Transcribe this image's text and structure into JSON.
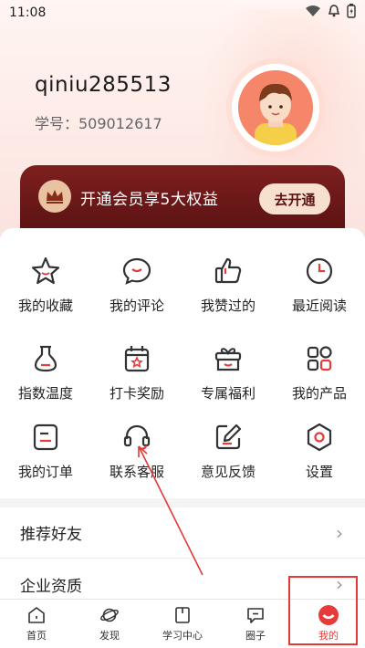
{
  "status_bar": {
    "time": "11:08"
  },
  "profile": {
    "username": "qiniu285513",
    "student_id": "学号：509012617"
  },
  "vip": {
    "text": "开通会员享5大权益",
    "button": "去开通"
  },
  "grid": [
    {
      "label": "我的收藏",
      "icon": "star-icon"
    },
    {
      "label": "我的评论",
      "icon": "comment-icon"
    },
    {
      "label": "我赞过的",
      "icon": "thumbs-up-icon"
    },
    {
      "label": "最近阅读",
      "icon": "clock-icon"
    },
    {
      "label": "指数温度",
      "icon": "flask-icon"
    },
    {
      "label": "打卡奖励",
      "icon": "calendar-star-icon"
    },
    {
      "label": "专属福利",
      "icon": "gift-box-icon"
    },
    {
      "label": "我的产品",
      "icon": "grid-apps-icon"
    },
    {
      "label": "我的订单",
      "icon": "order-icon"
    },
    {
      "label": "联系客服",
      "icon": "headset-icon"
    },
    {
      "label": "意见反馈",
      "icon": "feedback-edit-icon"
    },
    {
      "label": "设置",
      "icon": "hexagon-settings-icon"
    }
  ],
  "list": [
    {
      "label": "推荐好友"
    },
    {
      "label": "企业资质"
    }
  ],
  "tabbar": [
    {
      "label": "首页",
      "icon": "home-icon"
    },
    {
      "label": "发现",
      "icon": "planet-icon"
    },
    {
      "label": "学习中心",
      "icon": "book-icon"
    },
    {
      "label": "圈子",
      "icon": "chat-bubble-icon"
    },
    {
      "label": "我的",
      "icon": "me-icon",
      "active": true
    }
  ],
  "colors": {
    "accent": "#e63b3b",
    "vip_bg": "#6e1818",
    "vip_button": "#f8e0cf",
    "annotation": "#e53935"
  }
}
